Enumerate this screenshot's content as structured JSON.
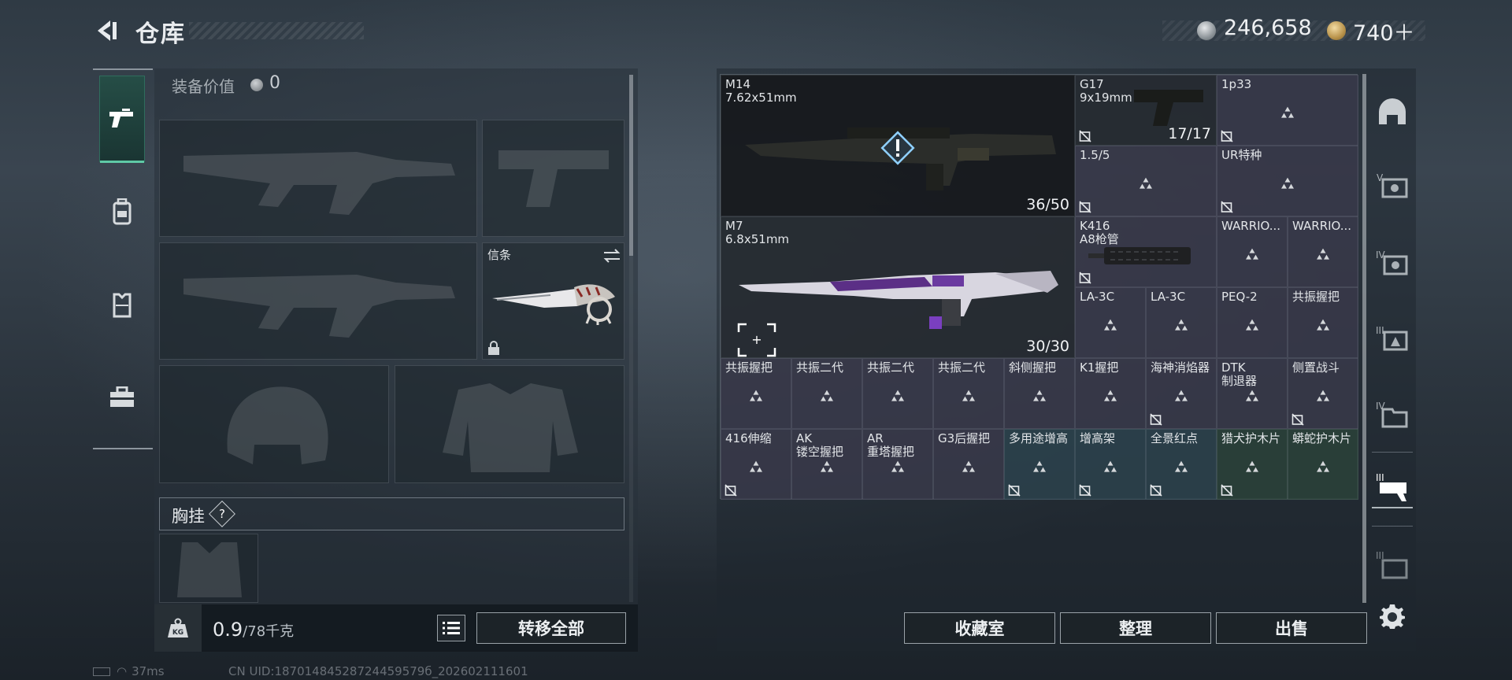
{
  "header": {
    "title": "仓库"
  },
  "currency": {
    "silver": "246,658",
    "gold": "740＋"
  },
  "left_rail": [
    "pistol-icon",
    "backpack-icon",
    "vest-icon",
    "toolbox-icon"
  ],
  "equipment": {
    "value_label": "装备价值",
    "value": "0",
    "knife_label": "信条",
    "chest_rig_label": "胸挂",
    "chest_rig_help": "?",
    "weight_value": "0.9",
    "weight_max": "/78千克",
    "kg_badge": "KG",
    "transfer_all": "转移全部"
  },
  "stash": {
    "items": [
      {
        "name": "M14",
        "sub": "7.62x51mm",
        "count": "36/50"
      },
      {
        "name": "G17",
        "sub": "9x19mm",
        "count": "17/17"
      },
      {
        "name": "1p33"
      },
      {
        "name": "1.5/5"
      },
      {
        "name": "UR特种"
      },
      {
        "name": "M7",
        "sub": "6.8x51mm",
        "count": "30/30"
      },
      {
        "name": "K416",
        "sub": "A8枪管"
      },
      {
        "name": "WARRIO..."
      },
      {
        "name": "WARRIO..."
      },
      {
        "name": "LA-3C"
      },
      {
        "name": "LA-3C"
      },
      {
        "name": "PEQ-2"
      },
      {
        "name": "共振握把"
      },
      {
        "name": "共振握把"
      },
      {
        "name": "共振二代"
      },
      {
        "name": "共振二代"
      },
      {
        "name": "共振二代"
      },
      {
        "name": "斜侧握把"
      },
      {
        "name": "K1握把"
      },
      {
        "name": "海神消焰器"
      },
      {
        "name": "DTK",
        "sub": "制退器"
      },
      {
        "name": "侧置战斗"
      },
      {
        "name": "416伸缩"
      },
      {
        "name": "AK",
        "sub": "镂空握把"
      },
      {
        "name": "AR",
        "sub": "重塔握把"
      },
      {
        "name": "G3后握把"
      },
      {
        "name": "多用途增高"
      },
      {
        "name": "增高架"
      },
      {
        "name": "全景红点"
      },
      {
        "name": "猎犬护木片"
      },
      {
        "name": "蟒蛇护木片"
      }
    ],
    "add_symbol": "+"
  },
  "actions": {
    "collection": "收藏室",
    "sort": "整理",
    "sell": "出售"
  },
  "right_rail": [
    "helmet-icon",
    "tier5-case-icon",
    "tier4-case-icon",
    "tier3-case-icon",
    "tier4-box-icon",
    "tier3-weapon-case-icon",
    "tier3-box-icon",
    "settings-icon"
  ],
  "status": {
    "ping": "37ms",
    "uid": "CN UID:18701484528724459579б_202602111601"
  }
}
